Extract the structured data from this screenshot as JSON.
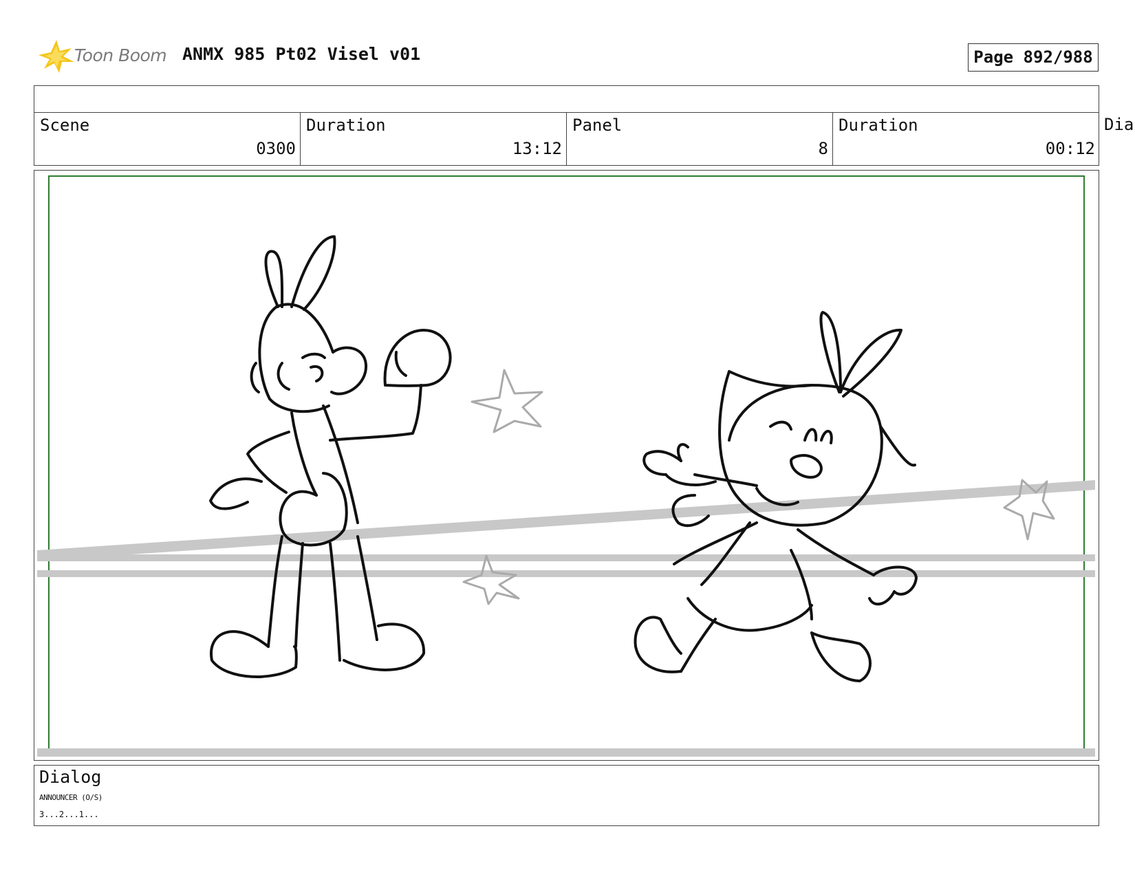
{
  "header": {
    "brand": "Toon Boom",
    "title": "ANMX 985 Pt02 Visel v01",
    "page": "Page 892/988"
  },
  "info": {
    "scene_label": "Scene",
    "scene_value": "0300",
    "scene_duration_label": "Duration",
    "scene_duration_value": "13:12",
    "panel_label": "Panel",
    "panel_value": "8",
    "panel_duration_label": "Duration",
    "panel_duration_value": "00:12",
    "dialog_cut_label": "Dia"
  },
  "dialog": {
    "label": "Dialog",
    "character": "ANNOUNCER (O/S)",
    "line": "3...2...1..."
  },
  "colors": {
    "safe_frame": "#2e7d32",
    "logo_star": "#f5c518",
    "sketch": "#111111",
    "sketch_light": "#b0b0b0"
  }
}
